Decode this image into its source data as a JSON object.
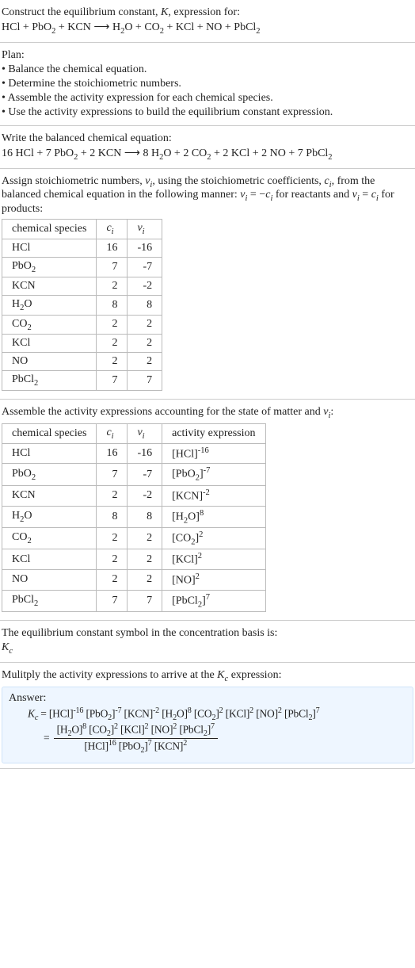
{
  "chart_data": {
    "type": "table",
    "title": "Stoichiometric numbers and activity expressions",
    "series": [
      {
        "name": "stoichiometric_numbers",
        "columns": [
          "chemical species",
          "c_i",
          "ν_i"
        ],
        "rows": [
          [
            "HCl",
            16,
            -16
          ],
          [
            "PbO2",
            7,
            -7
          ],
          [
            "KCN",
            2,
            -2
          ],
          [
            "H2O",
            8,
            8
          ],
          [
            "CO2",
            2,
            2
          ],
          [
            "KCl",
            2,
            2
          ],
          [
            "NO",
            2,
            2
          ],
          [
            "PbCl2",
            7,
            7
          ]
        ]
      },
      {
        "name": "activity_expressions",
        "columns": [
          "chemical species",
          "c_i",
          "ν_i",
          "activity expression"
        ],
        "rows": [
          [
            "HCl",
            16,
            -16,
            "[HCl]^-16"
          ],
          [
            "PbO2",
            7,
            -7,
            "[PbO2]^-7"
          ],
          [
            "KCN",
            2,
            -2,
            "[KCN]^-2"
          ],
          [
            "H2O",
            8,
            8,
            "[H2O]^8"
          ],
          [
            "CO2",
            2,
            2,
            "[CO2]^2"
          ],
          [
            "KCl",
            2,
            2,
            "[KCl]^2"
          ],
          [
            "NO",
            2,
            2,
            "[NO]^2"
          ],
          [
            "PbCl2",
            7,
            7,
            "[PbCl2]^7"
          ]
        ]
      }
    ]
  },
  "title1": "Construct the equilibrium constant, ",
  "title1_k": "K",
  "title1_tail": ", expression for:",
  "unbalanced_lhs1": "HCl + PbO",
  "unbalanced_lhs2": " + KCN",
  "unbalanced_arrow": " ⟶ ",
  "unbalanced_rhs1": "H",
  "unbalanced_rhs2": "O + CO",
  "unbalanced_rhs3": " + KCl + NO + PbCl",
  "plan_heading": "Plan:",
  "plan_item1": "• Balance the chemical equation.",
  "plan_item2": "• Determine the stoichiometric numbers.",
  "plan_item3": "• Assemble the activity expression for each chemical species.",
  "plan_item4": "• Use the activity expressions to build the equilibrium constant expression.",
  "balanced_heading": "Write the balanced chemical equation:",
  "bal_l1": "16 HCl + 7 PbO",
  "bal_l2": " + 2 KCN",
  "bal_arrow": " ⟶ ",
  "bal_r1": "8 H",
  "bal_r2": "O + 2 CO",
  "bal_r3": " + 2 KCl + 2 NO + 7 PbCl",
  "assign_text1": "Assign stoichiometric numbers, ",
  "assign_nu": "ν",
  "assign_sub_i": "i",
  "assign_text2": ", using the stoichiometric coefficients, ",
  "assign_c": "c",
  "assign_text3": ", from the balanced chemical equation in the following manner: ",
  "assign_eq1": " = −",
  "assign_text4": " for reactants and ",
  "assign_eq2": " = ",
  "assign_text5": " for products:",
  "table1": {
    "h1": "chemical species",
    "h2": "c",
    "h3": "ν",
    "rows": [
      {
        "sp_pre": "HCl",
        "sp_sub": "",
        "c": "16",
        "nu": "-16"
      },
      {
        "sp_pre": "PbO",
        "sp_sub": "2",
        "c": "7",
        "nu": "-7"
      },
      {
        "sp_pre": "KCN",
        "sp_sub": "",
        "c": "2",
        "nu": "-2"
      },
      {
        "sp_pre": "H",
        "sp_mid": "2",
        "sp_post": "O",
        "c": "8",
        "nu": "8"
      },
      {
        "sp_pre": "CO",
        "sp_sub": "2",
        "c": "2",
        "nu": "2"
      },
      {
        "sp_pre": "KCl",
        "sp_sub": "",
        "c": "2",
        "nu": "2"
      },
      {
        "sp_pre": "NO",
        "sp_sub": "",
        "c": "2",
        "nu": "2"
      },
      {
        "sp_pre": "PbCl",
        "sp_sub": "2",
        "c": "7",
        "nu": "7"
      }
    ]
  },
  "assemble_text1": "Assemble the activity expressions accounting for the state of matter and ",
  "assemble_text2": ":",
  "table2": {
    "h1": "chemical species",
    "h2": "c",
    "h3": "ν",
    "h4": "activity expression",
    "rows": [
      {
        "sp_pre": "HCl",
        "sp_sub": "",
        "c": "16",
        "nu": "-16",
        "act_pre": "[HCl]",
        "act_sup": "-16"
      },
      {
        "sp_pre": "PbO",
        "sp_sub": "2",
        "c": "7",
        "nu": "-7",
        "act_pre": "[PbO",
        "act_sub": "2",
        "act_mid": "]",
        "act_sup": "-7"
      },
      {
        "sp_pre": "KCN",
        "sp_sub": "",
        "c": "2",
        "nu": "-2",
        "act_pre": "[KCN]",
        "act_sup": "-2"
      },
      {
        "sp_pre": "H",
        "sp_mid": "2",
        "sp_post": "O",
        "c": "8",
        "nu": "8",
        "act_pre": "[H",
        "act_sub": "2",
        "act_mid": "O]",
        "act_sup": "8"
      },
      {
        "sp_pre": "CO",
        "sp_sub": "2",
        "c": "2",
        "nu": "2",
        "act_pre": "[CO",
        "act_sub": "2",
        "act_mid": "]",
        "act_sup": "2"
      },
      {
        "sp_pre": "KCl",
        "sp_sub": "",
        "c": "2",
        "nu": "2",
        "act_pre": "[KCl]",
        "act_sup": "2"
      },
      {
        "sp_pre": "NO",
        "sp_sub": "",
        "c": "2",
        "nu": "2",
        "act_pre": "[NO]",
        "act_sup": "2"
      },
      {
        "sp_pre": "PbCl",
        "sp_sub": "2",
        "c": "7",
        "nu": "7",
        "act_pre": "[PbCl",
        "act_sub": "2",
        "act_mid": "]",
        "act_sup": "7"
      }
    ]
  },
  "symbol_text1": "The equilibrium constant symbol in the concentration basis is:",
  "symbol_K": "K",
  "symbol_c": "c",
  "multiply_text1": "Mulitply the activity expressions to arrive at the ",
  "multiply_text2": " expression:",
  "answer_label": "Answer:",
  "kc": {
    "K": "K",
    "c": "c",
    "eq": " = ",
    "t1": "[HCl]",
    "s1": "-16",
    "t2": " [PbO",
    "sub2": "2",
    "t2b": "]",
    "s2": "-7",
    "t3": " [KCN]",
    "s3": "-2",
    "t4": " [H",
    "sub4": "2",
    "t4b": "O]",
    "s4": "8",
    "t5": " [CO",
    "sub5": "2",
    "t5b": "]",
    "s5": "2",
    "t6": " [KCl]",
    "s6": "2",
    "t7": " [NO]",
    "s7": "2",
    "t8": " [PbCl",
    "sub8": "2",
    "t8b": "]",
    "s8": "7",
    "eq2": "= ",
    "numA": "[H",
    "numAsub": "2",
    "numAb": "O]",
    "numAsup": "8",
    "numB": " [CO",
    "numBsub": "2",
    "numBb": "]",
    "numBsup": "2",
    "numC": " [KCl]",
    "numCsup": "2",
    "numD": " [NO]",
    "numDsup": "2",
    "numE": " [PbCl",
    "numEsub": "2",
    "numEb": "]",
    "numEsup": "7",
    "denA": "[HCl]",
    "denAsup": "16",
    "denB": " [PbO",
    "denBsub": "2",
    "denBb": "]",
    "denBsup": "7",
    "denC": " [KCN]",
    "denCsup": "2"
  }
}
